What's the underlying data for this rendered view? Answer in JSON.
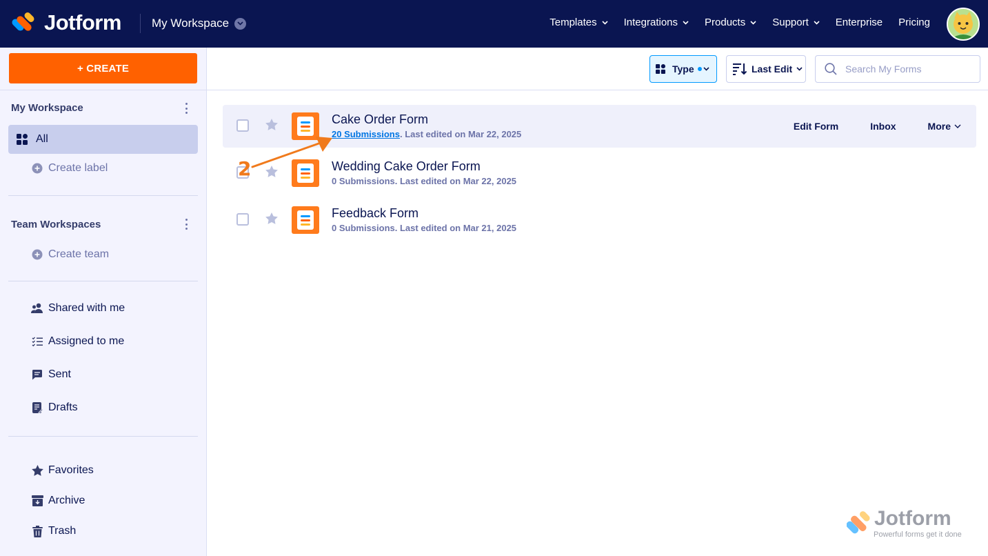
{
  "header": {
    "brand": "Jotform",
    "workspace": "My Workspace",
    "nav": [
      {
        "label": "Templates",
        "dropdown": true
      },
      {
        "label": "Integrations",
        "dropdown": true
      },
      {
        "label": "Products",
        "dropdown": true
      },
      {
        "label": "Support",
        "dropdown": true
      },
      {
        "label": "Enterprise",
        "dropdown": false
      },
      {
        "label": "Pricing",
        "dropdown": false
      }
    ]
  },
  "sidebar": {
    "create_label": "+ CREATE",
    "my_workspace_title": "My Workspace",
    "all_label": "All",
    "create_label_link": "Create label",
    "team_workspaces_title": "Team Workspaces",
    "create_team_link": "Create team",
    "items": [
      {
        "label": "Shared with me",
        "icon": "users-icon"
      },
      {
        "label": "Assigned to me",
        "icon": "checklist-icon"
      },
      {
        "label": "Sent",
        "icon": "message-icon"
      },
      {
        "label": "Drafts",
        "icon": "draft-icon"
      },
      {
        "label": "Favorites",
        "icon": "star-icon"
      },
      {
        "label": "Archive",
        "icon": "archive-icon"
      },
      {
        "label": "Trash",
        "icon": "trash-icon"
      }
    ]
  },
  "toolbar": {
    "type_label": "Type",
    "sort_label": "Last Edit",
    "search_placeholder": "Search My Forms"
  },
  "forms": [
    {
      "title": "Cake Order Form",
      "submissions": "20 Submissions",
      "edited": ". Last edited on Mar 22, 2025"
    },
    {
      "title": "Wedding Cake Order Form",
      "submissions": "0 Submissions",
      "edited": ". Last edited on Mar 22, 2025"
    },
    {
      "title": "Feedback Form",
      "submissions": "0 Submissions",
      "edited": ". Last edited on Mar 21, 2025"
    }
  ],
  "row_actions": {
    "edit": "Edit Form",
    "inbox": "Inbox",
    "more": "More"
  },
  "annotation": {
    "step": "2"
  },
  "watermark": {
    "brand": "Jotform",
    "tagline": "Powerful forms get it done"
  },
  "colors": {
    "navy": "#0a1551",
    "orange": "#ff6100",
    "blue": "#0099ff",
    "sidebar_bg": "#f3f3fe",
    "annotation": "#f07a1c"
  }
}
